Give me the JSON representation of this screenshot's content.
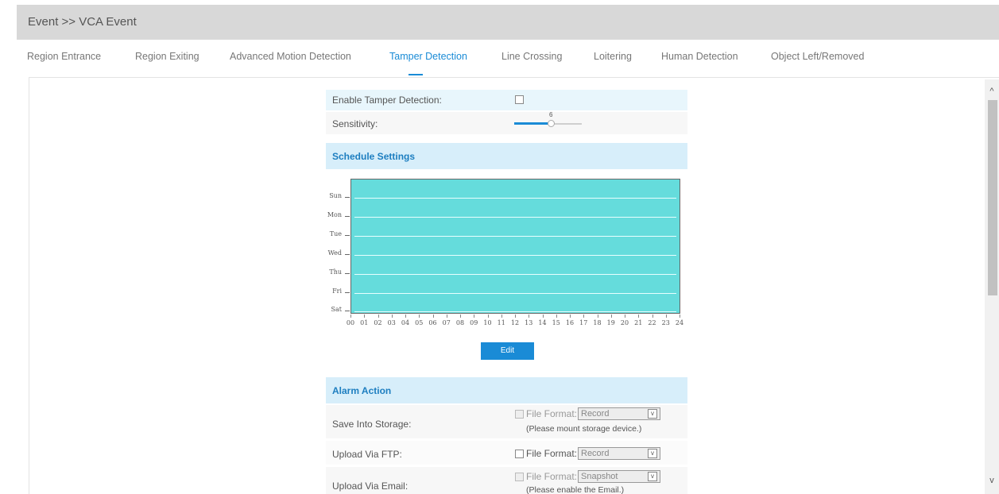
{
  "header": {
    "title": "Event >> VCA Event"
  },
  "tabs": [
    {
      "label": "Region Entrance"
    },
    {
      "label": "Region Exiting"
    },
    {
      "label": "Advanced Motion Detection"
    },
    {
      "label": "Tamper Detection"
    },
    {
      "label": "Line Crossing"
    },
    {
      "label": "Loitering"
    },
    {
      "label": "Human Detection"
    },
    {
      "label": "Object Left/Removed"
    }
  ],
  "active_tab": "Tamper Detection",
  "settings": {
    "enable_label": "Enable Tamper Detection:",
    "enable_checked": false,
    "sensitivity_label": "Sensitivity:",
    "sensitivity_value": "6"
  },
  "schedule": {
    "title": "Schedule Settings",
    "days": [
      "Sun",
      "Mon",
      "Tue",
      "Wed",
      "Thu",
      "Fri",
      "Sat"
    ],
    "hours": [
      "00",
      "01",
      "02",
      "03",
      "04",
      "05",
      "06",
      "07",
      "08",
      "09",
      "10",
      "11",
      "12",
      "13",
      "14",
      "15",
      "16",
      "17",
      "18",
      "19",
      "20",
      "21",
      "22",
      "23",
      "24"
    ],
    "edit_label": "Edit",
    "fill_color": "#65dcdc"
  },
  "alarm": {
    "title": "Alarm Action",
    "file_format_label": "File Format:",
    "storage": {
      "label": "Save Into Storage:",
      "format": "Record",
      "hint": "(Please mount storage device.)"
    },
    "ftp": {
      "label": "Upload Via FTP:",
      "format": "Record"
    },
    "email": {
      "label": "Upload Via Email:",
      "format": "Snapshot",
      "hint": "(Please enable the Email.)"
    }
  },
  "colors": {
    "accent": "#1a8bd6",
    "section_bg": "#d7eefa",
    "header_bg": "#d8d8d8"
  },
  "scroll": {
    "up_icon": "^",
    "down_icon": "v"
  }
}
